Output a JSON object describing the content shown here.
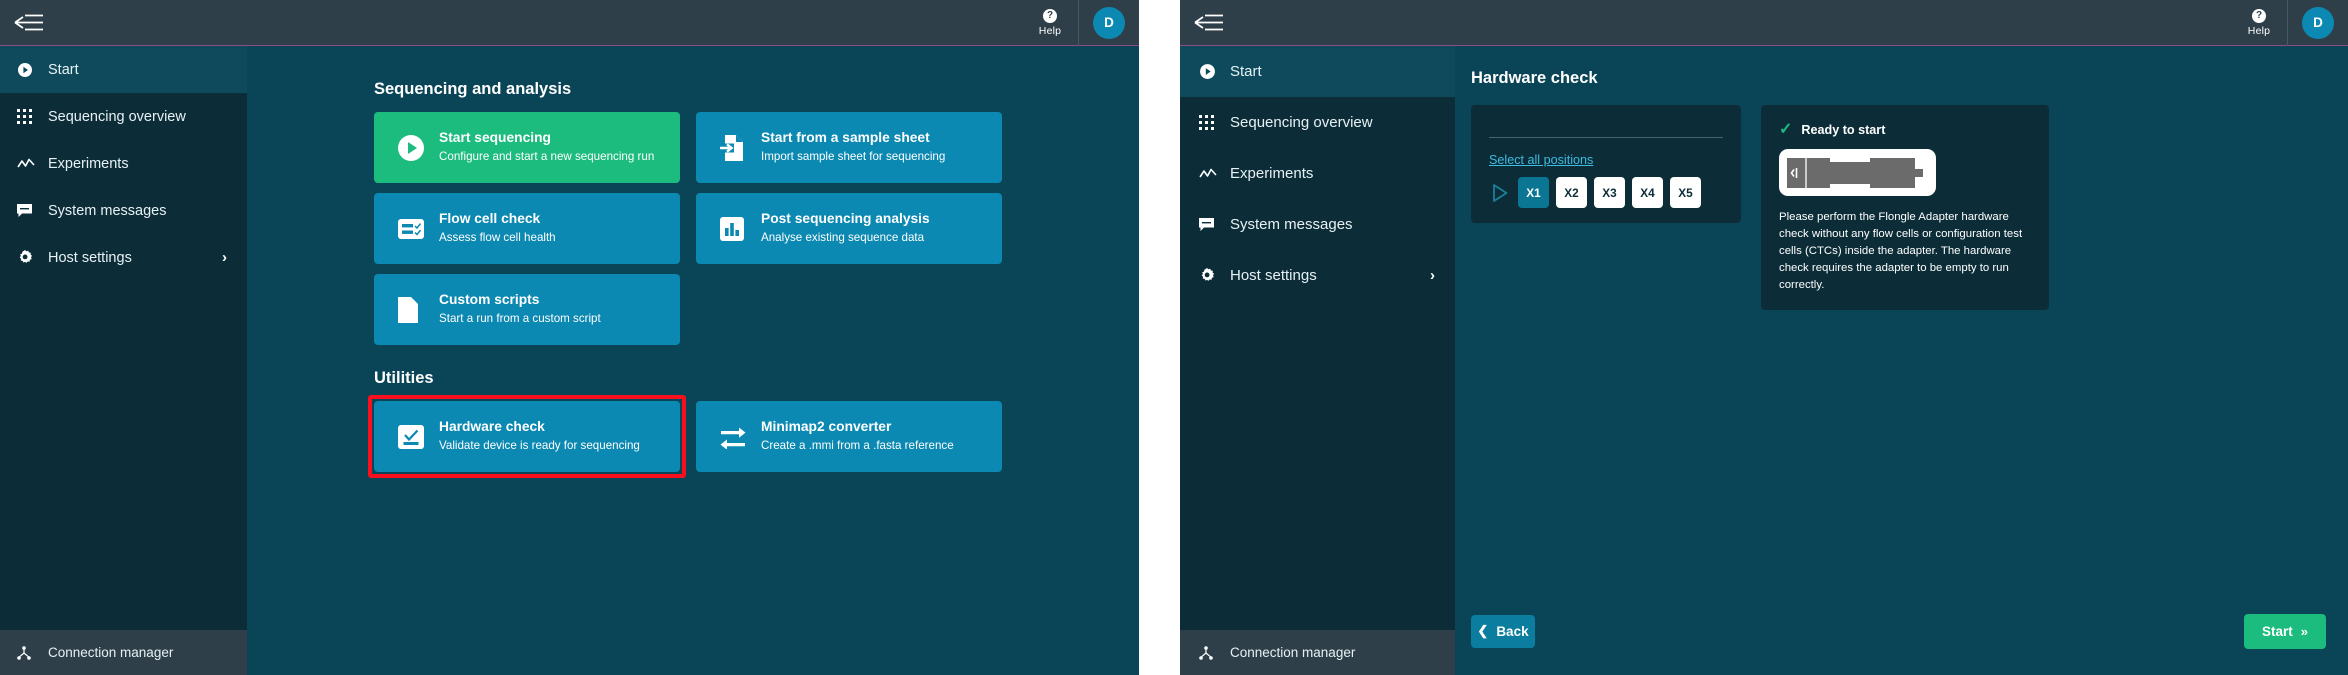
{
  "topbar": {
    "menu_icon": "back-hamburger-icon",
    "help_label": "Help",
    "help_icon": "question-mark-icon",
    "avatar_initial": "D"
  },
  "sidebar": {
    "items": [
      {
        "label": "Start",
        "icon": "play-circle-icon",
        "active": true,
        "chevron": ""
      },
      {
        "label": "Sequencing overview",
        "icon": "grid-dots-icon",
        "active": false,
        "chevron": ""
      },
      {
        "label": "Experiments",
        "icon": "line-chart-icon",
        "active": false,
        "chevron": ""
      },
      {
        "label": "System messages",
        "icon": "speech-bubble-icon",
        "active": false,
        "chevron": ""
      },
      {
        "label": "Host settings",
        "icon": "gear-icon",
        "active": false,
        "chevron": "›"
      }
    ],
    "connection_manager": {
      "label": "Connection manager",
      "icon": "network-node-icon"
    }
  },
  "start_page": {
    "sections": [
      {
        "title": "Sequencing and analysis",
        "cards": [
          {
            "title": "Start sequencing",
            "sub": "Configure and start a new sequencing run",
            "icon": "play-circle-filled-icon",
            "color": "green"
          },
          {
            "title": "Start from a sample sheet",
            "sub": "Import sample sheet for sequencing",
            "icon": "document-import-icon",
            "color": "blue"
          },
          {
            "title": "Flow cell check",
            "sub": "Assess flow cell health",
            "icon": "flow-cell-check-icon",
            "color": "blue"
          },
          {
            "title": "Post sequencing analysis",
            "sub": "Analyse existing sequence data",
            "icon": "bar-chart-icon",
            "color": "blue"
          },
          {
            "title": "Custom scripts",
            "sub": "Start a run from a custom script",
            "icon": "document-icon",
            "color": "blue"
          }
        ]
      },
      {
        "title": "Utilities",
        "cards": [
          {
            "title": "Hardware check",
            "sub": "Validate device is ready for sequencing",
            "icon": "hardware-check-icon",
            "color": "blue",
            "highlighted": true
          },
          {
            "title": "Minimap2 converter",
            "sub": "Create a .mmi from a .fasta reference",
            "icon": "convert-arrows-icon",
            "color": "blue"
          }
        ]
      }
    ],
    "highlight_color": "#fa0f1e"
  },
  "hardware_check": {
    "page_title": "Hardware check",
    "select_all_label": "Select all positions",
    "play_icon": "play-outline-icon",
    "positions": [
      {
        "label": "X1",
        "selected": true
      },
      {
        "label": "X2",
        "selected": false
      },
      {
        "label": "X3",
        "selected": false
      },
      {
        "label": "X4",
        "selected": false
      },
      {
        "label": "X5",
        "selected": false
      }
    ],
    "status": {
      "icon": "check-icon",
      "label": "Ready to start",
      "color": "#1cbc7f"
    },
    "adapter_image": "flongle-adapter-icon",
    "description": "Please perform the Flongle Adapter hardware check without any flow cells or configuration test cells (CTCs) inside the adapter. The hardware check requires the adapter to be empty to run correctly.",
    "back_button": {
      "label": "Back",
      "icon": "chevron-left-icon"
    },
    "start_button": {
      "label": "Start",
      "icon": "double-chevron-right-icon"
    }
  },
  "colors": {
    "accent_blue": "#0b89b2",
    "accent_green": "#1cbc7f",
    "sidebar_bg": "#0c2d38",
    "main_bg": "#0a4457",
    "topbar_bg": "#2f3f49",
    "topbar_underline": "#8e4b88",
    "link": "#3ebbe0"
  }
}
